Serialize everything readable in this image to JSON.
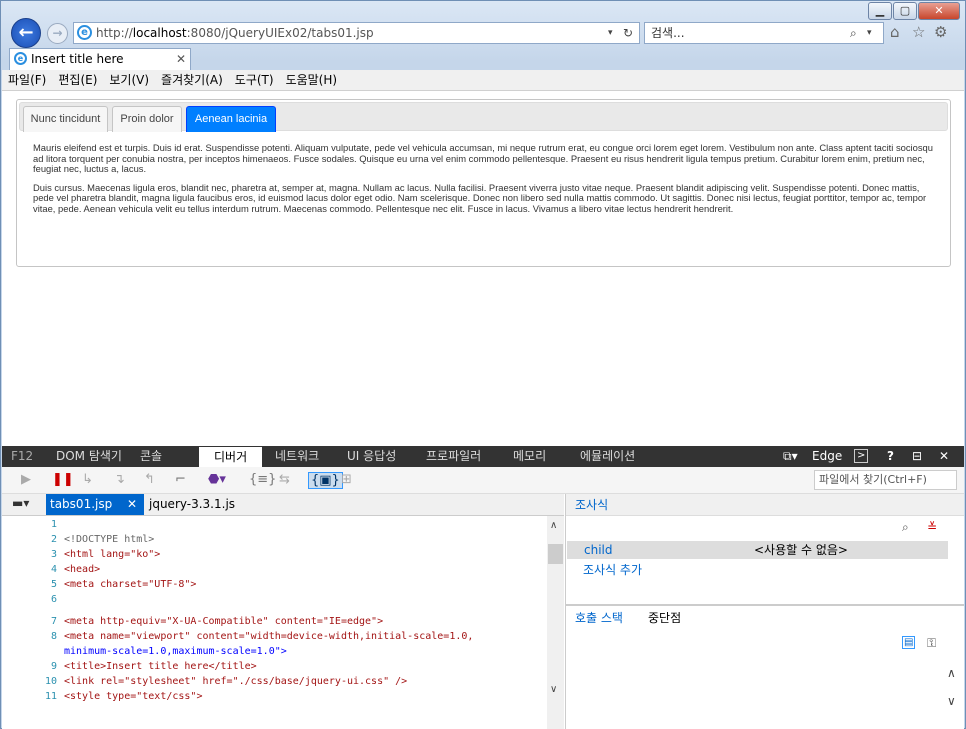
{
  "browser": {
    "url_prefix": "http://",
    "url_host": "localhost",
    "url_rest": ":8080/jQueryUIEx02/tabs01.jsp",
    "search_placeholder": "검색...",
    "tab_title": "Insert title here",
    "menu": [
      "파일(F)",
      "편집(E)",
      "보기(V)",
      "즐겨찾기(A)",
      "도구(T)",
      "도움말(H)"
    ]
  },
  "page": {
    "tabs": [
      "Nunc tincidunt",
      "Proin dolor",
      "Aenean lacinia"
    ],
    "active_tab": 2,
    "paragraphs": [
      "Mauris eleifend est et turpis. Duis id erat. Suspendisse potenti. Aliquam vulputate, pede vel vehicula accumsan, mi neque rutrum erat, eu congue orci lorem eget lorem. Vestibulum non ante. Class aptent taciti sociosqu ad litora torquent per conubia nostra, per inceptos himenaeos. Fusce sodales. Quisque eu urna vel enim commodo pellentesque. Praesent eu risus hendrerit ligula tempus pretium. Curabitur lorem enim, pretium nec, feugiat nec, luctus a, lacus.",
      "Duis cursus. Maecenas ligula eros, blandit nec, pharetra at, semper at, magna. Nullam ac lacus. Nulla facilisi. Praesent viverra justo vitae neque. Praesent blandit adipiscing velit. Suspendisse potenti. Donec mattis, pede vel pharetra blandit, magna ligula faucibus eros, id euismod lacus dolor eget odio. Nam scelerisque. Donec non libero sed nulla mattis commodo. Ut sagittis. Donec nisi lectus, feugiat porttitor, tempor ac, tempor vitae, pede. Aenean vehicula velit eu tellus interdum rutrum. Maecenas commodo. Pellentesque nec elit. Fusce in lacus. Vivamus a libero vitae lectus hendrerit hendrerit."
    ]
  },
  "devtools": {
    "tabs": [
      "F12",
      "DOM 탐색기",
      "콘솔",
      "디버거",
      "네트워크",
      "UI 응답성",
      "프로파일러",
      "메모리",
      "에뮬레이션"
    ],
    "active_tab": "디버거",
    "edge_label": "Edge",
    "find_placeholder": "파일에서 찾기(Ctrl+F)",
    "file_tabs": [
      "tabs01.jsp",
      "jquery-3.3.1.js"
    ],
    "code_lines": [
      {
        "n": "1",
        "t": ""
      },
      {
        "n": "2",
        "t": "<!DOCTYPE html>"
      },
      {
        "n": "3",
        "t": "<html lang=\"ko\">"
      },
      {
        "n": "4",
        "t": "<head>"
      },
      {
        "n": "5",
        "t": "<meta charset=\"UTF-8\">"
      },
      {
        "n": "6",
        "t": ""
      },
      {
        "n": "7",
        "t": "<meta http-equiv=\"X-UA-Compatible\" content=\"IE=edge\">"
      },
      {
        "n": "8",
        "t": "<meta name=\"viewport\" content=\"width=device-width,initial-scale=1.0,"
      },
      {
        "n": "",
        "t": "minimum-scale=1.0,maximum-scale=1.0\">"
      },
      {
        "n": "9",
        "t": "<title>Insert title here</title>"
      },
      {
        "n": "10",
        "t": "<link rel=\"stylesheet\" href=\"./css/base/jquery-ui.css\" />"
      },
      {
        "n": "11",
        "t": "<style type=\"text/css\">"
      }
    ],
    "watch_title": "조사식",
    "watch_items": [
      {
        "name": "child",
        "value": "<사용할 수 없음>"
      }
    ],
    "watch_add": "조사식 추가",
    "callstack_tab": "호출 스택",
    "breakpoints_tab": "중단점"
  }
}
